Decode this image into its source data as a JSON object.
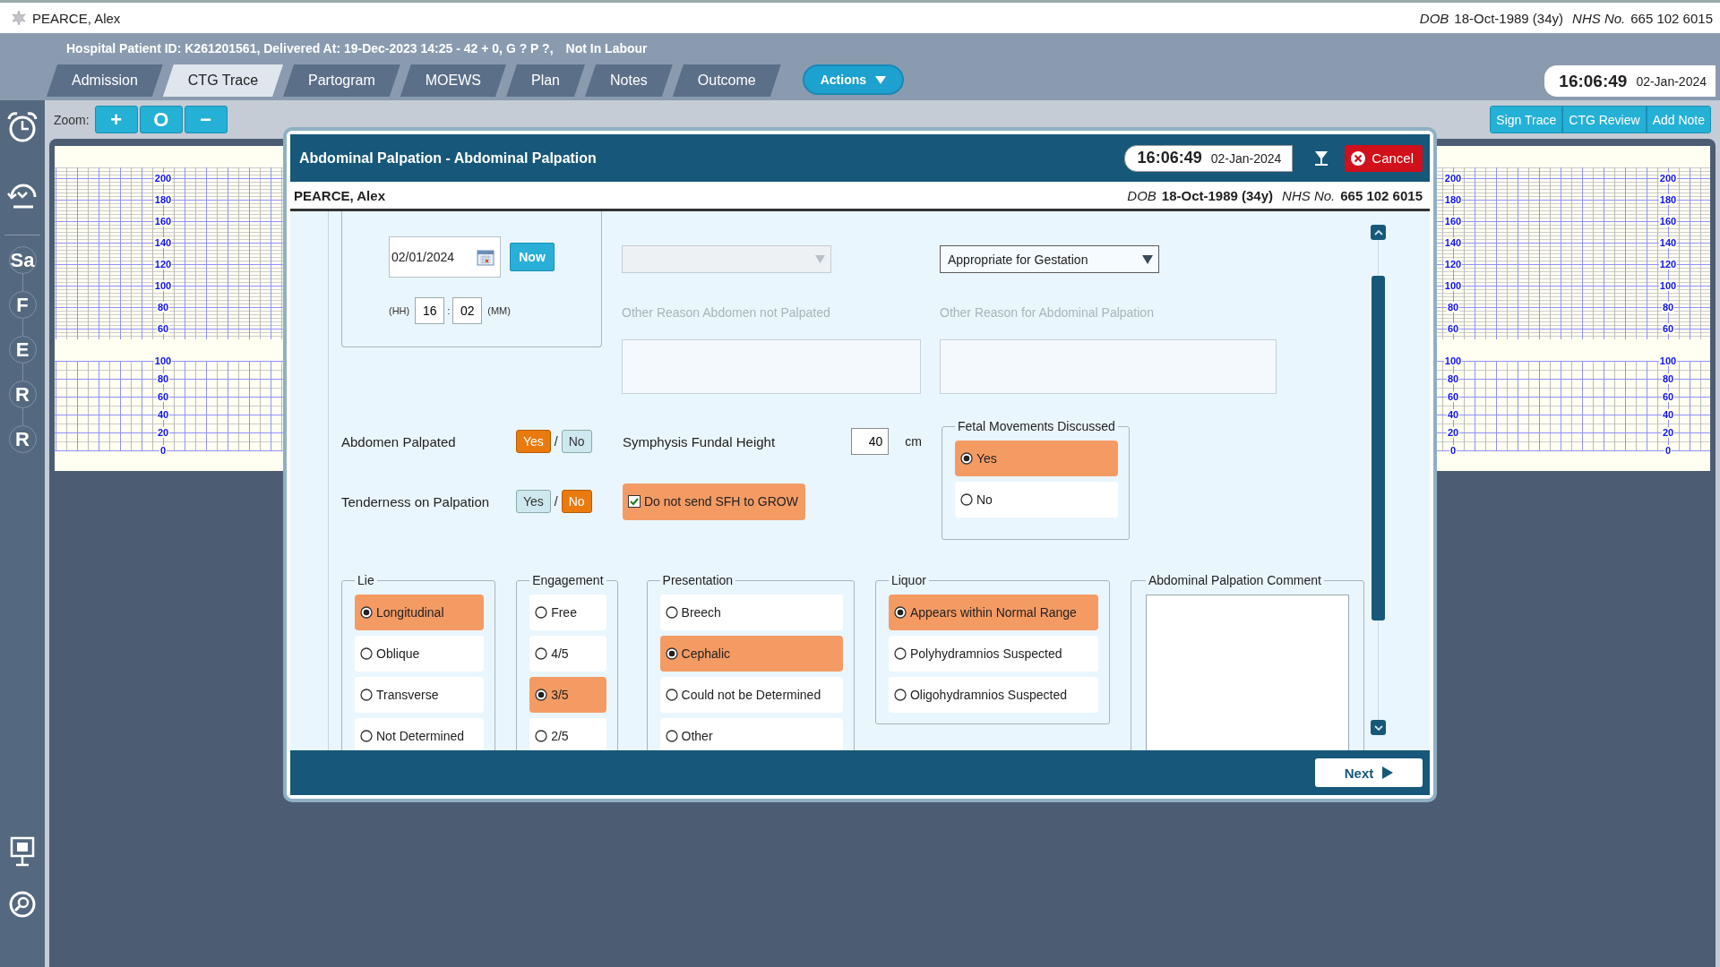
{
  "header": {
    "name": "PEARCE, Alex",
    "dob_label": "DOB",
    "dob": "18-Oct-1989 (34y)",
    "nhs_label": "NHS No.",
    "nhs": "665 102 6015"
  },
  "patient_info": {
    "details": "Hospital Patient ID: K261201561, Delivered At: 19-Dec-2023 14:25 - 42 + 0, G ? P ?,",
    "status": "Not In Labour"
  },
  "tabs": [
    {
      "label": "Admission",
      "selected": false
    },
    {
      "label": "CTG Trace",
      "selected": true
    },
    {
      "label": "Partogram",
      "selected": false
    },
    {
      "label": "MOEWS",
      "selected": false
    },
    {
      "label": "Plan",
      "selected": false
    },
    {
      "label": "Notes",
      "selected": false
    },
    {
      "label": "Outcome",
      "selected": false
    }
  ],
  "actions": "Actions",
  "clock": {
    "time": "16:06:49",
    "date": "02-Jan-2024"
  },
  "sidebar": {
    "sections": [
      "Sa",
      "F",
      "E",
      "R",
      "R"
    ]
  },
  "zoom": {
    "label": "Zoom:",
    "buttons": [
      "+",
      "O",
      "−"
    ]
  },
  "trace_buttons": [
    "Sign Trace",
    "CTG Review",
    "Add Note"
  ],
  "trace": {
    "scales": [
      {
        "fhr": [
          "200",
          "180",
          "160",
          "140",
          "120",
          "100",
          "80",
          "60"
        ],
        "toco": [
          "100",
          "80",
          "60",
          "40",
          "20",
          "0"
        ]
      },
      {
        "fhr": [
          "200",
          "180",
          "160",
          "140",
          "120",
          "100",
          "80",
          "60"
        ],
        "toco": [
          "100",
          "80",
          "60",
          "40",
          "20",
          "0"
        ]
      },
      {
        "fhr": [
          "200",
          "180",
          "160",
          "140",
          "120",
          "100",
          "80",
          "60"
        ],
        "toco": [
          "100",
          "80",
          "60",
          "40",
          "20",
          "0"
        ]
      }
    ]
  },
  "dialog": {
    "title": "Abdominal Palpation - Abdominal Palpation",
    "clock": {
      "time": "16:06:49",
      "date": "02-Jan-2024"
    },
    "cancel": "Cancel",
    "patient": {
      "name": "PEARCE, Alex",
      "dob_label": "DOB",
      "dob": "18-Oct-1989 (34y)",
      "nhs_label": "NHS No.",
      "nhs": "665 102 6015"
    },
    "date": {
      "value": "02/01/2024",
      "now": "Now",
      "hh_label": "(HH)",
      "hour": "16",
      "time_separator": ":",
      "minute": "02",
      "mm_label": "(MM)"
    },
    "reason_not_palpated": {
      "disabled": true,
      "other_label": "Other Reason Abdomen not Palpated",
      "other_disabled": true
    },
    "reason_palpation": {
      "value": "Appropriate for Gestation",
      "disabled": false,
      "other_label": "Other Reason for Abdominal Palpation",
      "other_disabled": true
    },
    "yes_no": [
      {
        "label": "Abdomen Palpated",
        "separator": "/",
        "options": [
          {
            "label": "Yes",
            "selected": true
          },
          {
            "label": "No",
            "selected": false
          }
        ]
      },
      {
        "label": "Tenderness on Palpation",
        "separator": "/",
        "options": [
          {
            "label": "Yes",
            "selected": false
          },
          {
            "label": "No",
            "selected": true
          }
        ]
      }
    ],
    "sfh": {
      "label": "Symphysis Fundal Height",
      "value": "40",
      "unit": "cm",
      "checkbox": {
        "label": "Do not send SFH to GROW",
        "checked": true
      }
    },
    "fetal_movements": {
      "legend": "Fetal Movements Discussed",
      "options": [
        {
          "label": "Yes",
          "selected": true
        },
        {
          "label": "No",
          "selected": false
        }
      ]
    },
    "groups": [
      {
        "legend": "Lie",
        "options": [
          {
            "label": "Longitudinal",
            "selected": true
          },
          {
            "label": "Oblique",
            "selected": false
          },
          {
            "label": "Transverse",
            "selected": false
          },
          {
            "label": "Not Determined",
            "selected": false
          }
        ]
      },
      {
        "legend": "Engagement",
        "options": [
          {
            "label": "Free",
            "selected": false
          },
          {
            "label": "4/5",
            "selected": false
          },
          {
            "label": "3/5",
            "selected": true
          },
          {
            "label": "2/5",
            "selected": false
          }
        ]
      },
      {
        "legend": "Presentation",
        "options": [
          {
            "label": "Breech",
            "selected": false
          },
          {
            "label": "Cephalic",
            "selected": true
          },
          {
            "label": "Could not be Determined",
            "selected": false
          },
          {
            "label": "Other",
            "selected": false
          }
        ]
      },
      {
        "legend": "Liquor",
        "options": [
          {
            "label": "Appears within Normal Range",
            "selected": true
          },
          {
            "label": "Polyhydramnios Suspected",
            "selected": false
          },
          {
            "label": "Oligohydramnios Suspected",
            "selected": false
          }
        ]
      }
    ],
    "comment": {
      "legend": "Abdominal Palpation Comment"
    },
    "next": "Next"
  }
}
